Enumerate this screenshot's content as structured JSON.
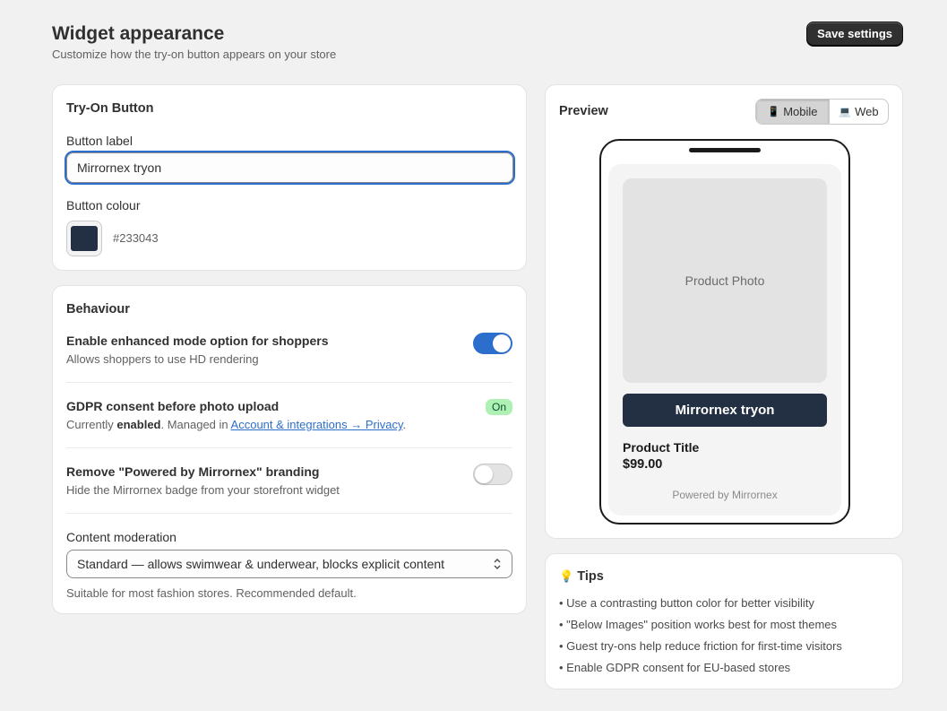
{
  "header": {
    "title": "Widget appearance",
    "subtitle": "Customize how the try-on button appears on your store",
    "save_label": "Save settings"
  },
  "tryon_card": {
    "title": "Try-On Button",
    "button_label_label": "Button label",
    "button_label_value": "Mirrornex tryon",
    "button_colour_label": "Button colour",
    "button_colour_hex": "#233043"
  },
  "behaviour": {
    "title": "Behaviour",
    "enhanced": {
      "title": "Enable enhanced mode option for shoppers",
      "desc": "Allows shoppers to use HD rendering",
      "enabled": true
    },
    "gdpr": {
      "title": "GDPR consent before photo upload",
      "desc_prefix": "Currently ",
      "desc_bold": "enabled",
      "desc_middle": ". Managed in ",
      "desc_link": "Account & integrations → Privacy",
      "desc_suffix": ".",
      "badge": "On"
    },
    "branding": {
      "title": "Remove \"Powered by Mirrornex\" branding",
      "desc": "Hide the Mirrornex badge from your storefront widget",
      "enabled": false
    },
    "moderation": {
      "label": "Content moderation",
      "selected": "Standard — allows swimwear & underwear, blocks explicit content",
      "helper": "Suitable for most fashion stores. Recommended default."
    }
  },
  "preview": {
    "title": "Preview",
    "tabs": [
      {
        "icon": "📱",
        "label": "Mobile",
        "active": true
      },
      {
        "icon": "💻",
        "label": "Web",
        "active": false
      }
    ],
    "photo_placeholder": "Product Photo",
    "tryon_label": "Mirrornex tryon",
    "product_title": "Product Title",
    "product_price": "$99.00",
    "powered_by": "Powered by Mirrornex"
  },
  "tips": {
    "icon": "💡",
    "title": "Tips",
    "items": [
      "• Use a contrasting button color for better visibility",
      "• \"Below Images\" position works best for most themes",
      "• Guest try-ons help reduce friction for first-time visitors",
      "• Enable GDPR consent for EU-based stores"
    ]
  },
  "colors": {
    "button_colour": "#233043",
    "accent": "#2c6ecb"
  }
}
